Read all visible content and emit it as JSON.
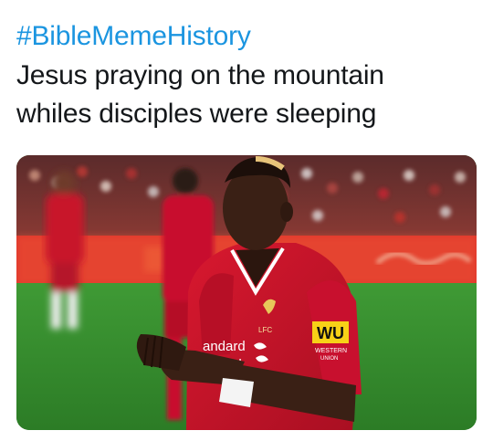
{
  "tweet": {
    "hashtag": "#BibleMemeHistory",
    "text_lines": [
      "Jesus praying on the mountain",
      "whiles disciples were sleeping"
    ],
    "colors": {
      "hashtag": "#1b95e0",
      "text": "#14171a",
      "background": "#ffffff"
    }
  },
  "media": {
    "description_icon": "photo",
    "shirt_sponsor": "andard",
    "shirt_sponsor_2": "ed",
    "sleeve_badge": "WU",
    "sleeve_text_1": "WESTERN",
    "sleeve_text_2": "UNION",
    "crest_text": "LFC",
    "colors": {
      "pitch": "#2e8a2a",
      "shirt": "#c8102e",
      "ad_board": "#e3342a"
    }
  }
}
